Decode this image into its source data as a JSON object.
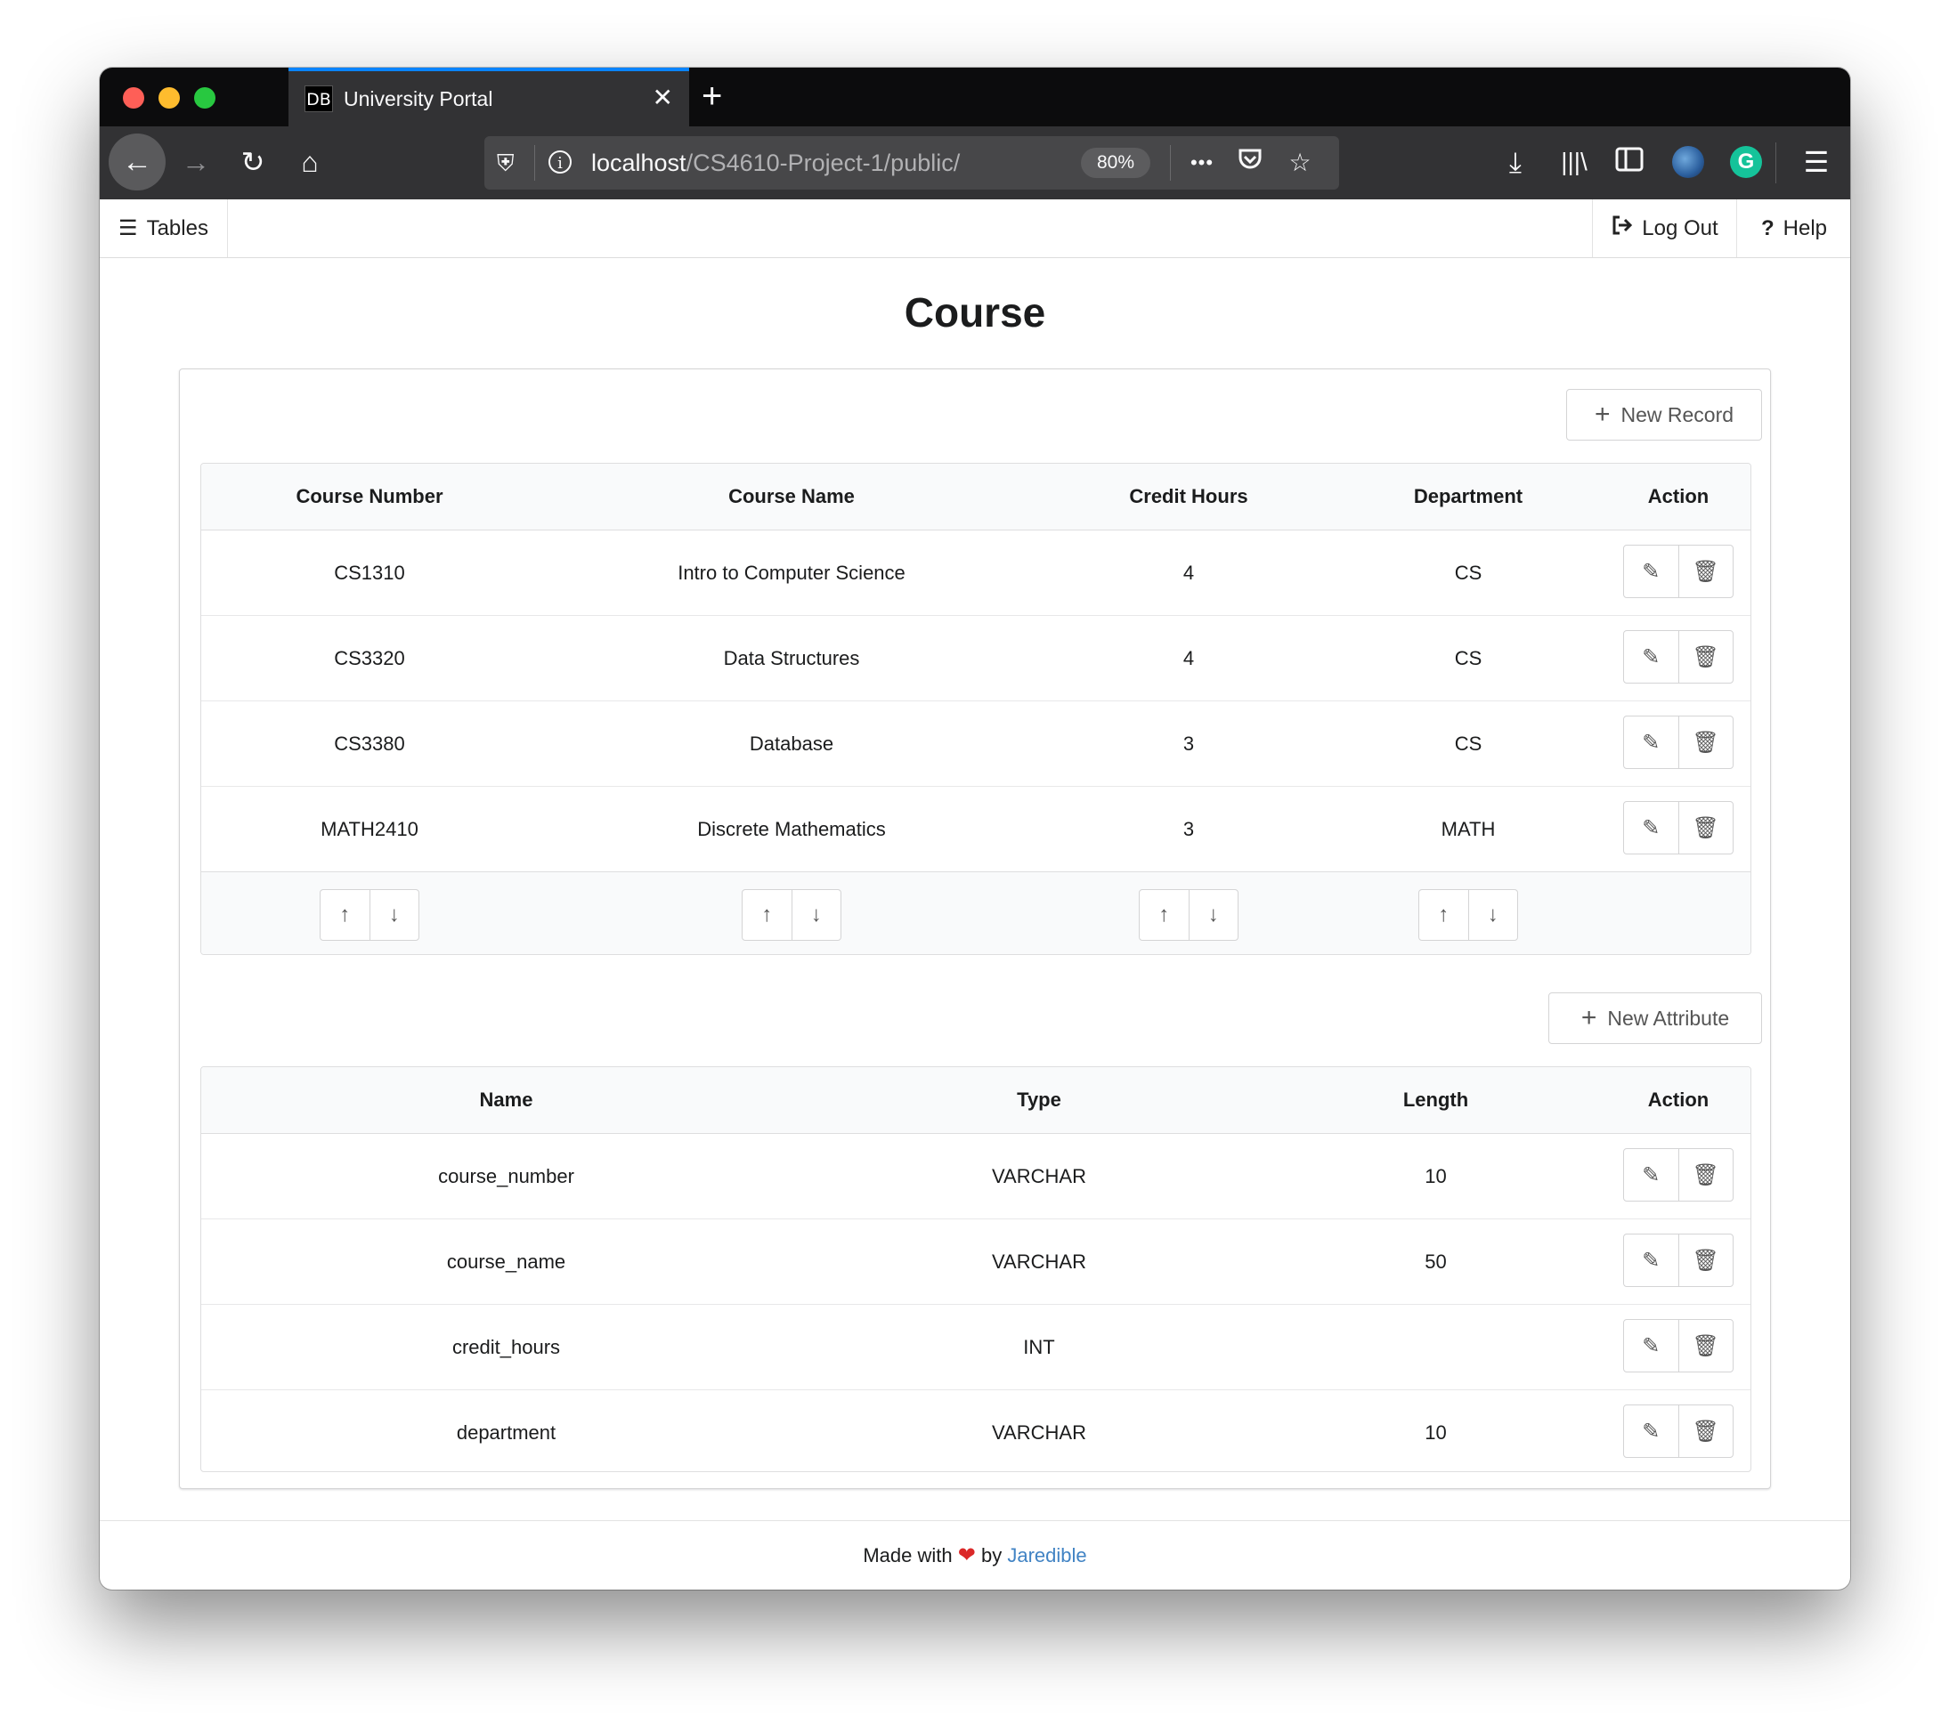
{
  "browser": {
    "tab_favicon": "DB",
    "tab_title": "University Portal",
    "tab_close": "✕",
    "new_tab": "+",
    "url_host": "localhost",
    "url_path": "/CS4610-Project-1/public/",
    "zoom": "80%",
    "page_actions": "•••"
  },
  "navbar": {
    "tables_label": "Tables",
    "logout_label": "Log Out",
    "help_label": "Help"
  },
  "page": {
    "title": "Course",
    "new_record_label": "New Record",
    "new_attribute_label": "New Attribute"
  },
  "records": {
    "headers": [
      "Course Number",
      "Course Name",
      "Credit Hours",
      "Department",
      "Action"
    ],
    "rows": [
      [
        "CS1310",
        "Intro to Computer Science",
        "4",
        "CS"
      ],
      [
        "CS3320",
        "Data Structures",
        "4",
        "CS"
      ],
      [
        "CS3380",
        "Database",
        "3",
        "CS"
      ],
      [
        "MATH2410",
        "Discrete Mathematics",
        "3",
        "MATH"
      ]
    ]
  },
  "attributes": {
    "headers": [
      "Name",
      "Type",
      "Length",
      "Action"
    ],
    "rows": [
      [
        "course_number",
        "VARCHAR",
        "10"
      ],
      [
        "course_name",
        "VARCHAR",
        "50"
      ],
      [
        "credit_hours",
        "INT",
        ""
      ],
      [
        "department",
        "VARCHAR",
        "10"
      ]
    ]
  },
  "footer": {
    "made_with": "Made with",
    "by": "by",
    "author": "Jaredible"
  }
}
